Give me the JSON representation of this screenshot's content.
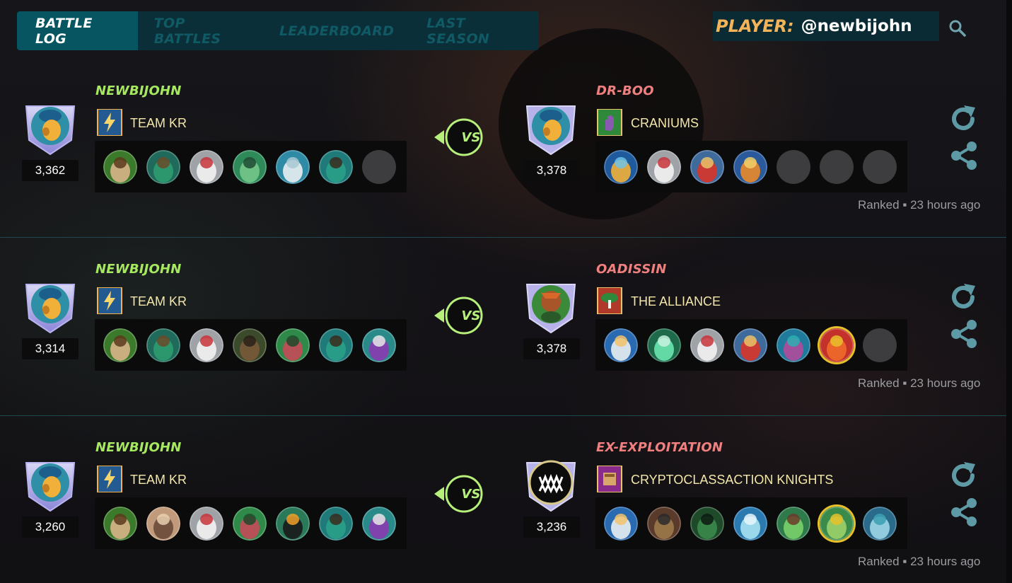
{
  "nav": {
    "tabs": [
      {
        "label": "BATTLE LOG",
        "active": true
      },
      {
        "label": "TOP BATTLES",
        "active": false
      },
      {
        "label": "LEADERBOARD",
        "active": false
      },
      {
        "label": "LAST SEASON",
        "active": false
      }
    ]
  },
  "player": {
    "label": "PLAYER:",
    "name": "@newbijohn"
  },
  "icons": {
    "search": "search-icon",
    "replay": "replay-icon",
    "share": "share-icon"
  },
  "colors": {
    "accent": "#075561",
    "left_name": "#a6e85f",
    "right_name": "#f07f7f",
    "guild_text": "#f3e7a9",
    "player_label": "#f4b45a"
  },
  "battles": [
    {
      "left": {
        "name": "NEWBIJOHN",
        "rating": "3,362",
        "guild": "TEAM KR",
        "cards": [
          "c-green-hair",
          "c-forest",
          "c-white-wing",
          "c-zombie-green",
          "c-elder-white",
          "c-teal-warrior",
          "empty"
        ]
      },
      "vs": "VS",
      "right": {
        "name": "DR-BOO",
        "rating": "3,378",
        "guild": "CRANIUMS",
        "cards": [
          "c-blue-mage",
          "c-white-wing",
          "c-red-dwarf",
          "c-archer",
          "empty",
          "empty",
          "empty"
        ]
      },
      "meta": {
        "type": "Ranked",
        "time": "23 hours ago"
      }
    },
    {
      "left": {
        "name": "NEWBIJOHN",
        "rating": "3,314",
        "guild": "TEAM KR",
        "cards": [
          "c-green-hair",
          "c-forest",
          "c-white-wing",
          "c-brown-beast",
          "c-green-goblin",
          "c-teal-warrior",
          "c-purple-striped"
        ]
      },
      "vs": "VS",
      "right": {
        "name": "OADISSIN",
        "rating": "3,378",
        "guild": "THE ALLIANCE",
        "cards": [
          "c-elder-blue",
          "c-cyan-tank",
          "c-white-wing",
          "c-red-dwarf",
          "c-pink-fairy",
          "c-gold-dragon",
          "empty"
        ]
      },
      "meta": {
        "type": "Ranked",
        "time": "23 hours ago"
      }
    },
    {
      "left": {
        "name": "NEWBIJOHN",
        "rating": "3,260",
        "guild": "TEAM KR",
        "cards": [
          "c-green-hair",
          "c-brawler",
          "c-white-wing",
          "c-green-goblin",
          "c-dark-knight",
          "c-teal-warrior",
          "c-purple-striped"
        ]
      },
      "vs": "VS",
      "right": {
        "name": "EX-EXPLOITATION",
        "rating": "3,236",
        "guild": "CRYPTOCLASSACTION KNIGHTS",
        "cards": [
          "c-elder-blue",
          "c-mech",
          "c-frog",
          "c-ice-spirit",
          "c-medusa",
          "c-gold-troll",
          "c-sea-spirit"
        ]
      },
      "meta": {
        "type": "Ranked",
        "time": "23 hours ago"
      }
    }
  ]
}
